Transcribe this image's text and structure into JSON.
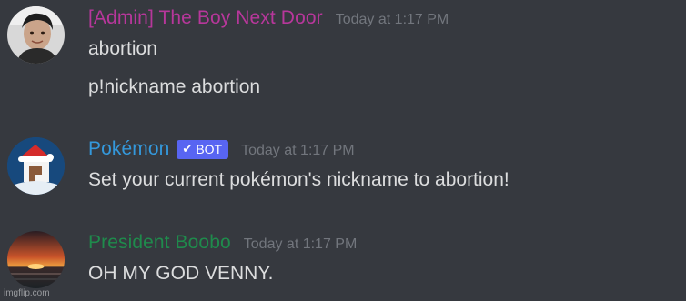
{
  "messages": [
    {
      "username": "[Admin] The Boy Next Door",
      "username_color": "#b7379b",
      "timestamp": "Today at 1:17 PM",
      "lines": [
        "abortion",
        "p!nickname abortion"
      ]
    },
    {
      "username": "Pokémon",
      "username_color": "#3498db",
      "badge_icon": "checkmark-icon",
      "badge": "BOT",
      "badge_color": "#5865f2",
      "timestamp": "Today at 1:17 PM",
      "lines": [
        "Set your current pokémon's nickname to abortion!"
      ]
    },
    {
      "username": "President Boobo",
      "username_color": "#1f8b4c",
      "timestamp": "Today at 1:17 PM",
      "lines": [
        "OH MY GOD VENNY."
      ]
    }
  ],
  "watermark": "imgflip.com"
}
